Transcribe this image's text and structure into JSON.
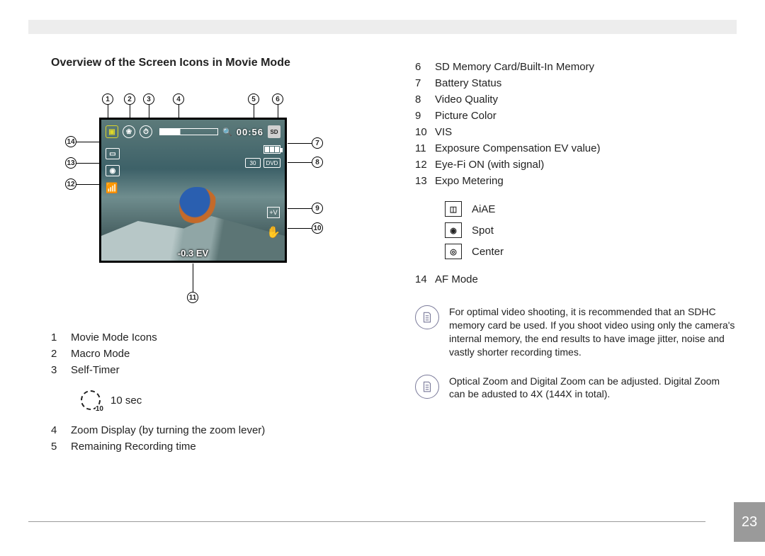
{
  "title": "Overview of the Screen Icons in Movie Mode",
  "page_number": "23",
  "osd": {
    "rec_time": "00:56",
    "sd_label": "SD",
    "chip30": "30",
    "dvd": "DVD",
    "ev_text": "-0.3 EV",
    "v_label": "+V"
  },
  "callouts": {
    "n1": "1",
    "n2": "2",
    "n3": "3",
    "n4": "4",
    "n5": "5",
    "n6": "6",
    "n7": "7",
    "n8": "8",
    "n9": "9",
    "n10": "10",
    "n11": "11",
    "n12": "12",
    "n13": "13",
    "n14": "14"
  },
  "left_list": [
    {
      "n": "1",
      "t": "Movie Mode Icons"
    },
    {
      "n": "2",
      "t": "Macro Mode"
    },
    {
      "n": "3",
      "t": "Self-Timer"
    }
  ],
  "left_sub": [
    {
      "icon": "timer-10",
      "label": "10 sec"
    }
  ],
  "left_list2": [
    {
      "n": "4",
      "t": "Zoom Display (by turning the zoom lever)"
    },
    {
      "n": "5",
      "t": "Remaining Recording time"
    }
  ],
  "right_list": [
    {
      "n": "6",
      "t": "SD Memory Card/Built-In Memory"
    },
    {
      "n": "7",
      "t": "Battery Status"
    },
    {
      "n": "8",
      "t": "Video Quality"
    },
    {
      "n": "9",
      "t": "Picture Color"
    },
    {
      "n": "10",
      "t": "VIS"
    },
    {
      "n": "11",
      "t": "Exposure Compensation EV value)"
    },
    {
      "n": "12",
      "t": "Eye-Fi ON (with signal)"
    },
    {
      "n": "13",
      "t": "Expo Metering"
    }
  ],
  "metering_sub": [
    {
      "label": "AiAE"
    },
    {
      "label": "Spot"
    },
    {
      "label": "Center"
    }
  ],
  "right_list2": [
    {
      "n": "14",
      "t": "AF Mode"
    }
  ],
  "notes": [
    "For optimal video shooting, it is recommended that an SDHC memory card be used. If you shoot video using only the camera's internal memory, the end results to have image jitter, noise and vastly shorter recording times.",
    "Optical Zoom and Digital Zoom can be adjusted. Digital Zoom can be adusted to 4X (144X in total)."
  ]
}
